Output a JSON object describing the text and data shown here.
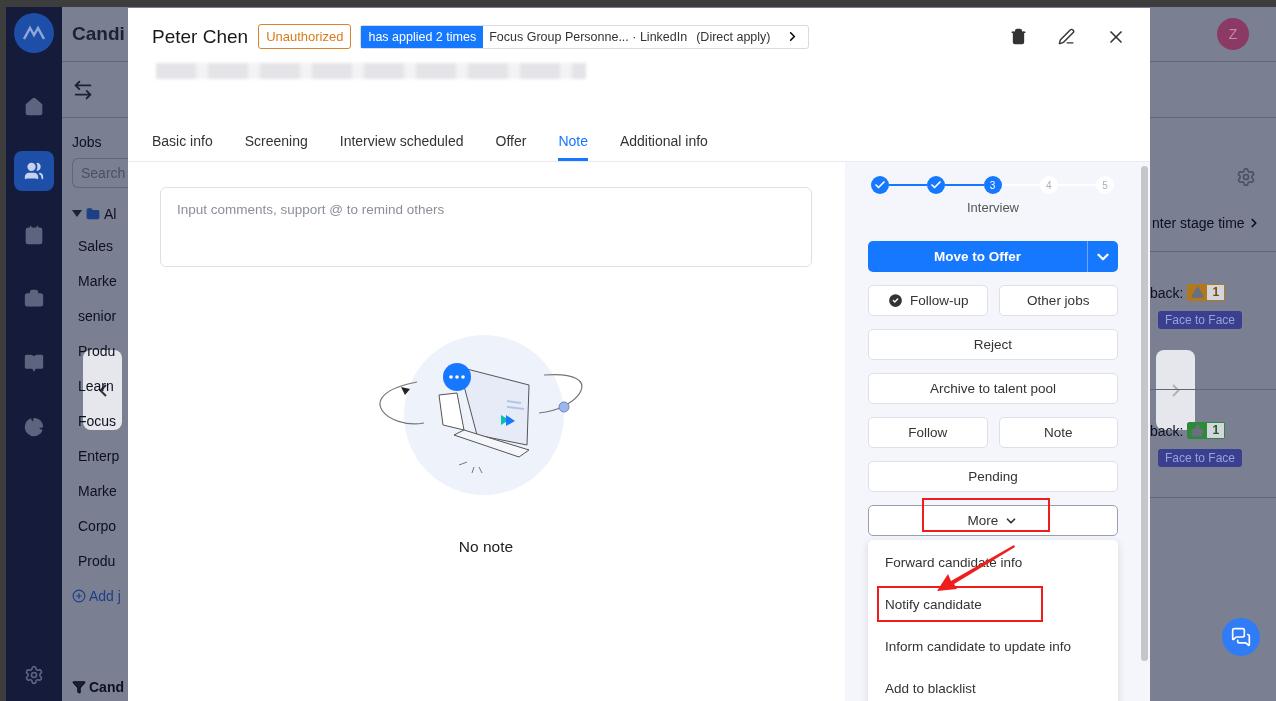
{
  "app": {
    "title": "Candi",
    "jobs_heading": "Jobs",
    "search_placeholder": "Search",
    "folder": "Al",
    "jobs": [
      "Sales",
      "Marke",
      "senior",
      "Produ",
      "Learn",
      "Focus",
      "Enterp",
      "Marke",
      "Corpo",
      "Produ"
    ],
    "add_job": "Add j",
    "filter_label": "Cand",
    "avatar": "Z",
    "sort_label": "nter stage time",
    "feedback": [
      {
        "label": "back:",
        "kind": "warning",
        "count": "1",
        "tag": "Face to Face"
      },
      {
        "label": "back:",
        "kind": "thumb",
        "count": "1",
        "tag": "Face to Face"
      }
    ]
  },
  "nav": [
    {
      "kind": "home",
      "selected": false
    },
    {
      "kind": "people",
      "selected": true
    },
    {
      "kind": "calendar",
      "selected": false
    },
    {
      "kind": "briefcase",
      "selected": false
    },
    {
      "kind": "book",
      "selected": false
    },
    {
      "kind": "chart",
      "selected": false
    }
  ],
  "candidate": {
    "name": "Peter Chen",
    "status_tag": "Unauthorized",
    "applied": "has applied 2 times",
    "source": "Focus Group Personne... · LinkedIn",
    "apply_type": "(Direct apply)"
  },
  "tabs": [
    {
      "label": "Basic info",
      "selected": false
    },
    {
      "label": "Screening",
      "selected": false
    },
    {
      "label": "Interview scheduled",
      "selected": false
    },
    {
      "label": "Offer",
      "selected": false
    },
    {
      "label": "Note",
      "selected": true
    },
    {
      "label": "Additional info",
      "selected": false
    }
  ],
  "note": {
    "placeholder": "Input comments, support @ to remind others",
    "empty_text": "No note"
  },
  "stepper": {
    "steps": [
      {
        "done": true,
        "reached": true
      },
      {
        "done": true,
        "reached": true
      },
      {
        "done": false,
        "reached": true,
        "number": "3"
      },
      {
        "done": false,
        "reached": false,
        "number": "4"
      },
      {
        "done": false,
        "reached": false,
        "number": "5"
      }
    ],
    "stage": "Interview"
  },
  "actions": [
    {
      "label": "Move to Offer",
      "kind": "primary",
      "marked": false
    },
    {
      "label": "Follow-up",
      "kind": "check",
      "marked": false
    },
    {
      "label": "Other jobs",
      "kind": "half",
      "marked": false
    },
    {
      "label": "Reject",
      "kind": "full",
      "marked": false
    },
    {
      "label": "Archive to talent pool",
      "kind": "full",
      "marked": false
    },
    {
      "label": "Follow",
      "kind": "half",
      "marked": false
    },
    {
      "label": "Note",
      "kind": "half",
      "marked": false
    },
    {
      "label": "Pending",
      "kind": "full",
      "marked": false
    },
    {
      "label": "More",
      "kind": "more",
      "marked": true
    }
  ],
  "more_menu": [
    {
      "label": "Forward candidate info",
      "marked": false
    },
    {
      "label": "Notify candidate",
      "marked": true
    },
    {
      "label": "Inform candidate to update info",
      "marked": false
    },
    {
      "label": "Add to blacklist",
      "marked": false
    }
  ]
}
